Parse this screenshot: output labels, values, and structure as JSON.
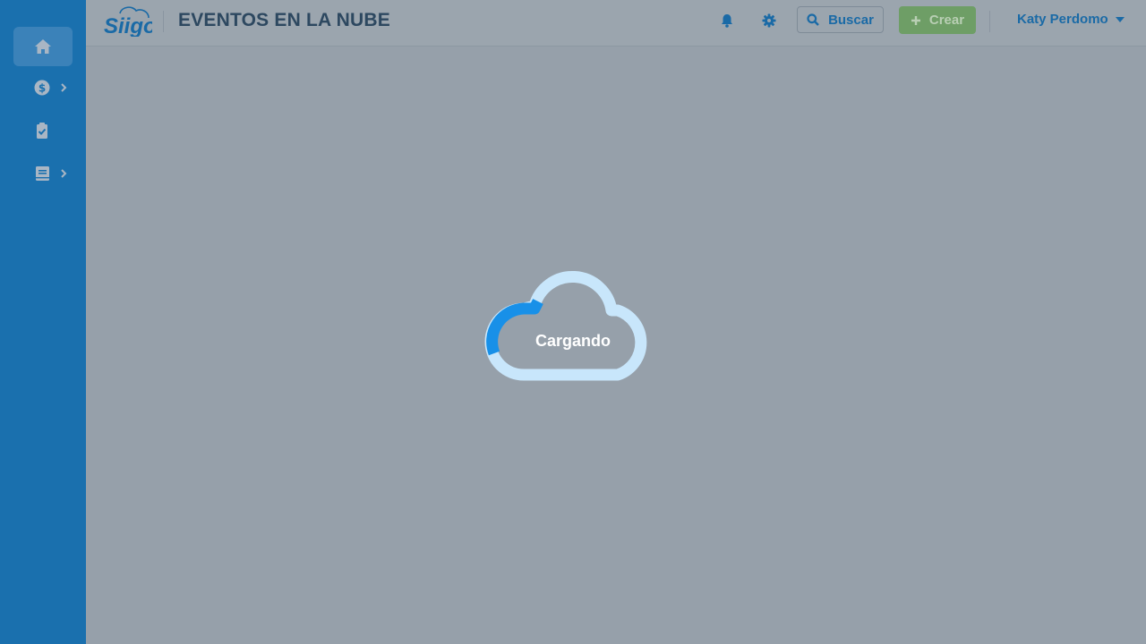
{
  "app": {
    "logo_text": "Siigo"
  },
  "header": {
    "title": "EVENTOS EN LA NUBE",
    "search_label": "Buscar",
    "create_label": "Crear",
    "user_name": "Katy Perdomo"
  },
  "sidebar": {
    "items": [
      {
        "icon": "home-icon",
        "active": true,
        "has_submenu": false
      },
      {
        "icon": "dollar-circle-icon",
        "active": false,
        "has_submenu": true
      },
      {
        "icon": "clipboard-check-icon",
        "active": false,
        "has_submenu": false
      },
      {
        "icon": "book-icon",
        "active": false,
        "has_submenu": true
      }
    ]
  },
  "loader": {
    "text": "Cargando"
  },
  "colors": {
    "sidebar": "#1a70ae",
    "overlay": "#96a0aa",
    "accent": "#1a6aa6",
    "create_button": "#6e9e66",
    "loader_ring": "#c8e6fb",
    "loader_progress": "#1890e8"
  }
}
